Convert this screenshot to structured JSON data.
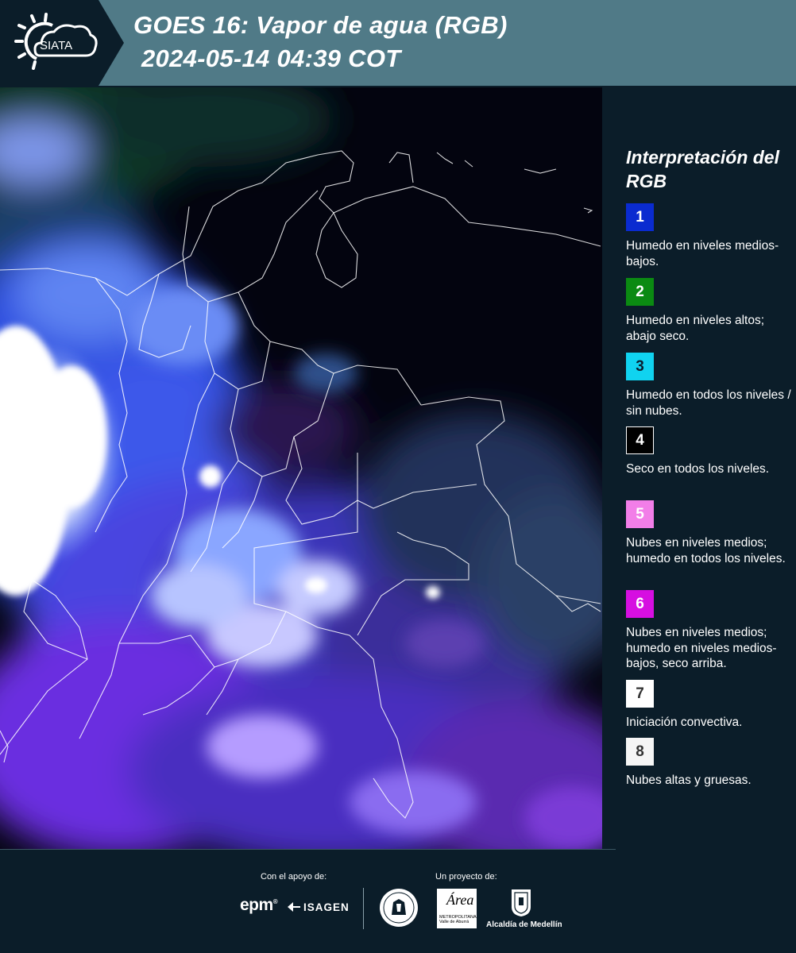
{
  "header": {
    "logo_text": "SIATA",
    "title_line1": "GOES 16: Vapor de agua (RGB)",
    "title_line2": "2024-05-14 04:39 COT",
    "background_color": "#507a87",
    "logo_panel_color": "#0b1d29"
  },
  "map": {
    "product": "water vapor RGB satellite composite",
    "overlay": "country and department borders (white outlines)"
  },
  "legend": {
    "title": "Interpretación del RGB",
    "items": [
      {
        "number": "1",
        "color": "#0a2bd0",
        "text_color": "#ffffff",
        "text": "Humedo en niveles medios-bajos."
      },
      {
        "number": "2",
        "color": "#0b8a12",
        "text_color": "#ffffff",
        "text": "Humedo en niveles altos; abajo seco."
      },
      {
        "number": "3",
        "color": "#10d3f0",
        "text_color": "#0a2030",
        "text": "Humedo en todos los niveles / sin nubes."
      },
      {
        "number": "4",
        "color": "#000000",
        "text_color": "#ffffff",
        "text": "Seco en todos los niveles."
      },
      {
        "number": "5",
        "color": "#f27ee8",
        "text_color": "#ffffff",
        "text": "Nubes en niveles medios; humedo en todos los niveles."
      },
      {
        "number": "6",
        "color": "#d60fe1",
        "text_color": "#ffffff",
        "text": "Nubes en niveles medios; humedo en niveles medios-bajos, seco arriba."
      },
      {
        "number": "7",
        "color": "#ffffff",
        "text_color": "#333333",
        "text": "Iniciación convectiva."
      },
      {
        "number": "8",
        "color": "#f5f5f5",
        "text_color": "#333333",
        "text": "Nubes altas y gruesas."
      }
    ]
  },
  "footer": {
    "support_label": "Con el apoyo de:",
    "project_label": "Un proyecto de:",
    "sponsor_epm": "epm",
    "sponsor_isagen": "ISAGEN",
    "area_logo_word": "Área",
    "area_logo_sub": "METROPOLITANA Valle de Aburrá",
    "alcaldia_label": "Alcaldía de Medellín"
  }
}
